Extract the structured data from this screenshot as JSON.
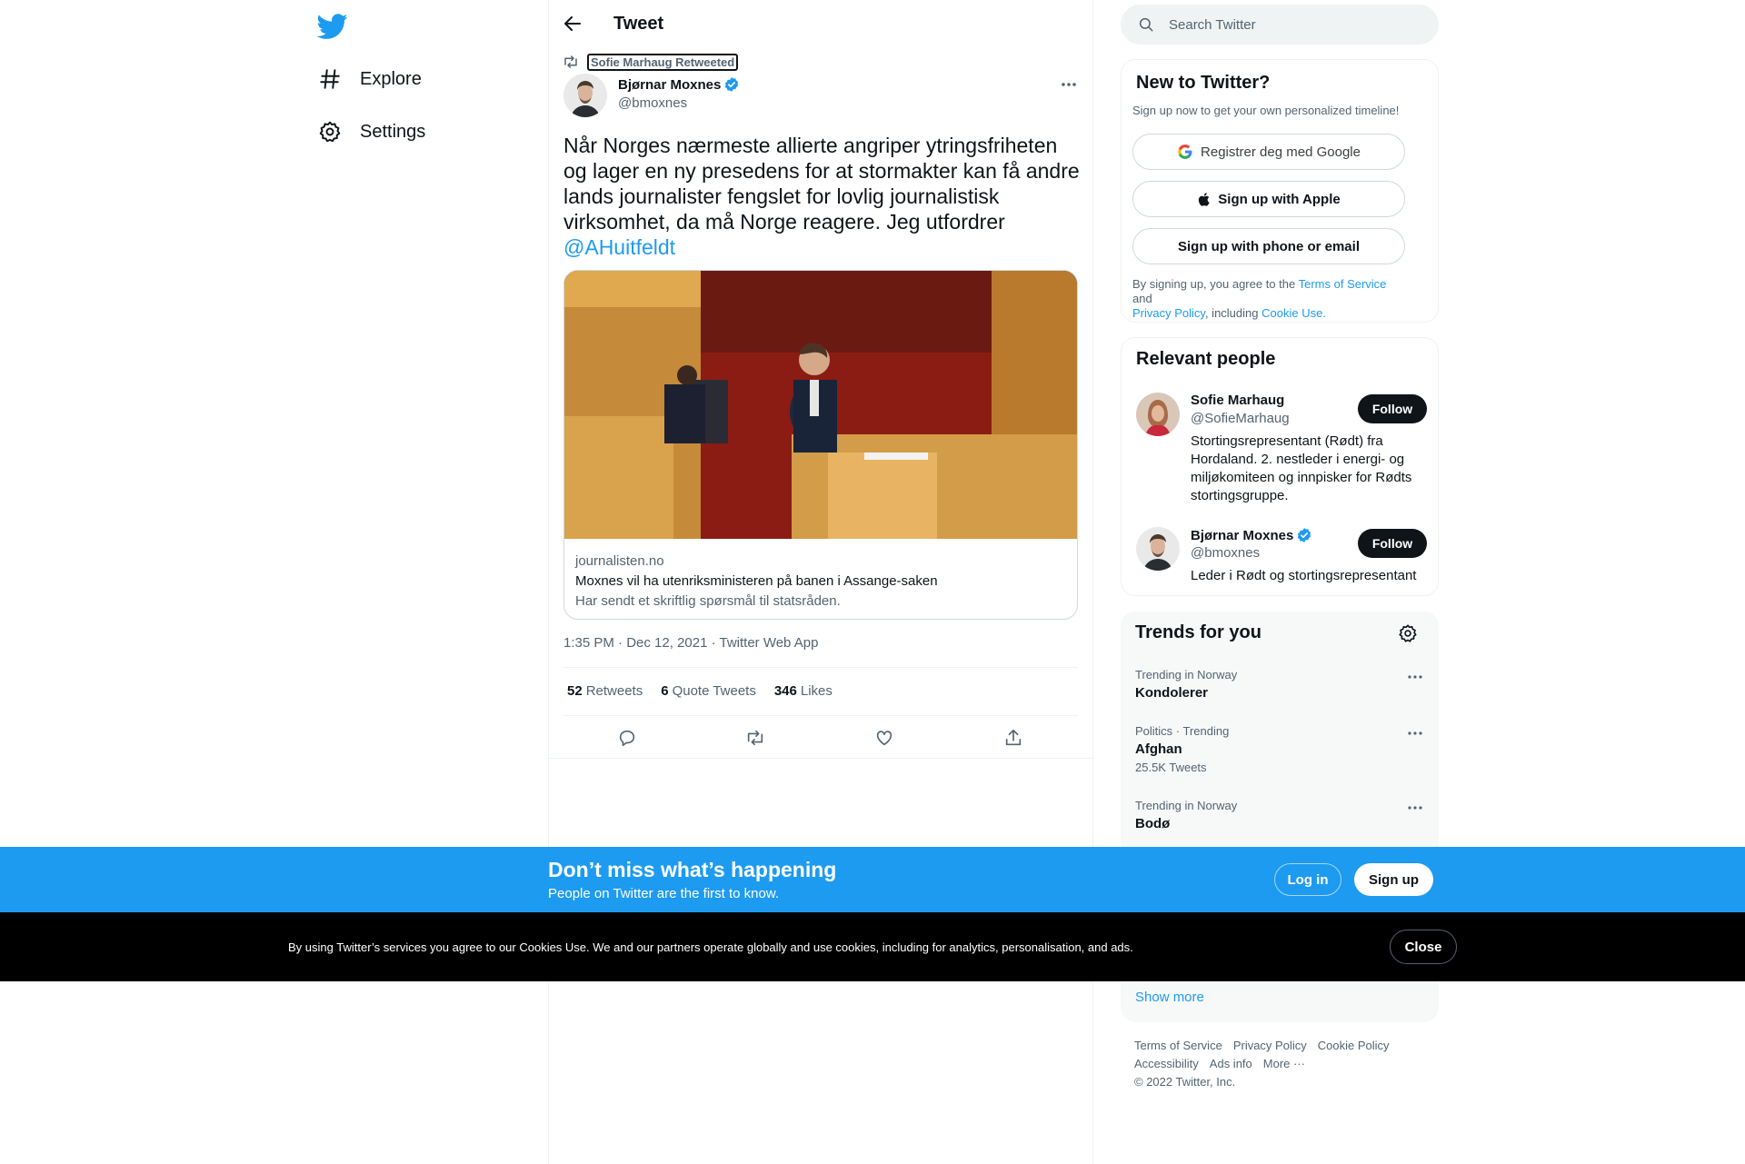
{
  "colors": {
    "accent": "#1d9bf0",
    "text": "#0f1419",
    "muted": "#536471",
    "cookie_bg": "#000000"
  },
  "nav": {
    "logo": "twitter-bird-icon",
    "items": [
      {
        "label": "Explore",
        "icon": "hashtag-icon"
      },
      {
        "label": "Settings",
        "icon": "gear-icon"
      }
    ]
  },
  "header": {
    "title": "Tweet"
  },
  "tweet": {
    "retweeted_by": "Sofie Marhaug Retweeted",
    "author_name": "Bjørnar Moxnes",
    "author_handle": "@bmoxnes",
    "text": "Når Norges nærmeste allierte angriper ytringsfriheten og lager en ny presedens for at stormakter kan få andre lands journalister fengslet for lovlig journalistisk virksomhet, da må Norge reagere. Jeg utfordrer ",
    "mention": "@AHuitfeldt",
    "card": {
      "domain": "journalisten.no",
      "title": "Moxnes vil ha utenriksministeren på banen i Assange-saken",
      "description": "Har sendt et skriftlig spørsmål til statsråden."
    },
    "meta": "1:35 PM · Dec 12, 2021 · Twitter Web App",
    "stats": {
      "retweets": "52",
      "retweets_label": "Retweets",
      "quotes": "6",
      "quotes_label": "Quote Tweets",
      "likes": "346",
      "likes_label": "Likes"
    }
  },
  "search": {
    "placeholder": "Search Twitter"
  },
  "new_to_twitter": {
    "title": "New to Twitter?",
    "subtitle": "Sign up now to get your own personalized timeline!",
    "google": "Registrer deg med Google",
    "apple": "Sign up with Apple",
    "phone": "Sign up with phone or email",
    "terms_1": "By signing up, you agree to the ",
    "terms_link_1": "Terms of Service",
    "terms_2": " and ",
    "terms_link_2": "Privacy Policy",
    "terms_3": ", including ",
    "terms_link_3": "Cookie Use."
  },
  "relevant_people": {
    "title": "Relevant people",
    "people": [
      {
        "name": "Sofie Marhaug",
        "handle": "@SofieMarhaug",
        "bio": "Stortingsrepresentant (Rødt) fra Hordaland. 2. nestleder i energi- og miljøkomiteen og innpisker for Rødts stortingsgruppe.",
        "follow": "Follow"
      },
      {
        "name": "Bjørnar Moxnes",
        "handle": "@bmoxnes",
        "bio": "Leder i Rødt og stortingsrepresentant",
        "follow": "Follow"
      }
    ]
  },
  "trends": {
    "title": "Trends for you",
    "items": [
      {
        "context": "Trending in Norway",
        "name": "Kondolerer",
        "count": ""
      },
      {
        "context": "Politics · Trending",
        "name": "Afghan",
        "count": "25.5K Tweets"
      },
      {
        "context": "Trending in Norway",
        "name": "Bodø",
        "count": ""
      }
    ],
    "show_more": "Show more"
  },
  "footer": {
    "links": [
      "Terms of Service",
      "Privacy Policy",
      "Cookie Policy",
      "Accessibility",
      "Ads info",
      "More ···"
    ],
    "copyright": "© 2022 Twitter, Inc."
  },
  "signup_bar": {
    "title": "Don’t miss what’s happening",
    "subtitle": "People on Twitter are the first to know.",
    "login": "Log in",
    "signup": "Sign up"
  },
  "cookie_bar": {
    "text": "By using Twitter’s services you agree to our Cookies Use. We and our partners operate globally and use cookies, including for analytics, personalisation, and ads.",
    "close": "Close"
  }
}
